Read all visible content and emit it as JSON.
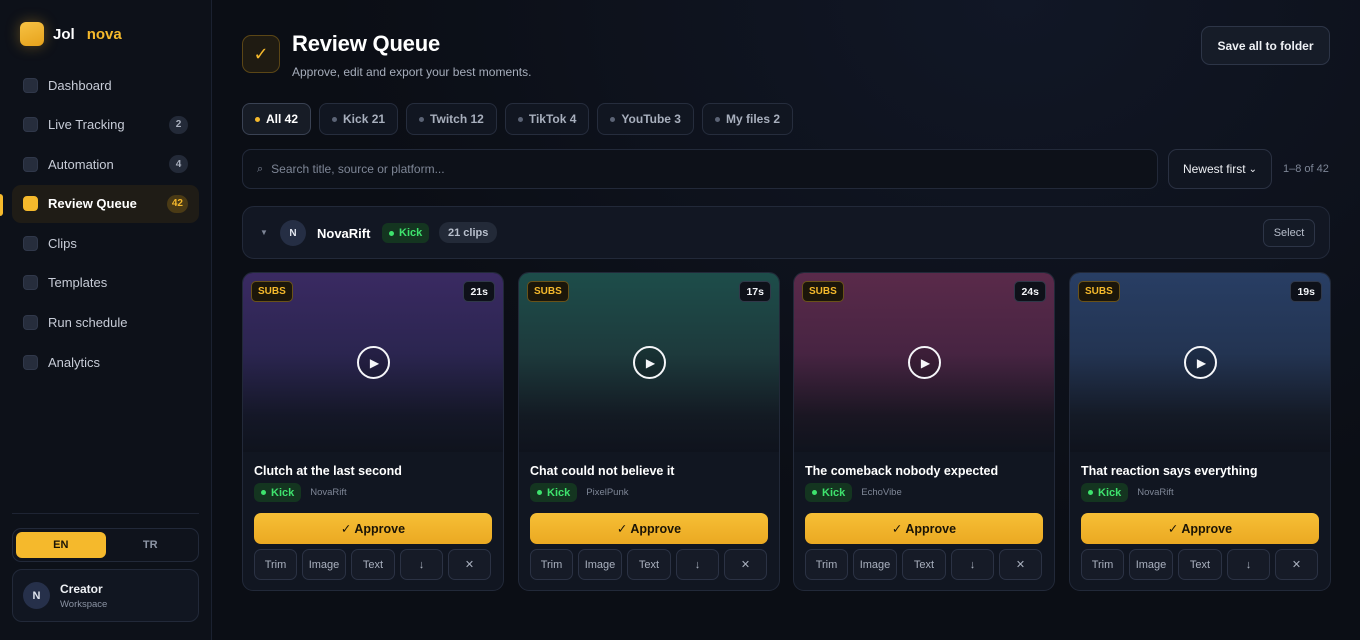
{
  "brand": {
    "name_a": "Jol",
    "name_b": "nova"
  },
  "sidebar": {
    "items": [
      {
        "label": "Dashboard",
        "badge": ""
      },
      {
        "label": "Live Tracking",
        "badge": "2"
      },
      {
        "label": "Automation",
        "badge": "4"
      },
      {
        "label": "Review Queue",
        "badge": "42",
        "active": true
      },
      {
        "label": "Clips",
        "badge": ""
      },
      {
        "label": "Templates",
        "badge": ""
      },
      {
        "label": "Run schedule",
        "badge": ""
      },
      {
        "label": "Analytics",
        "badge": ""
      }
    ],
    "languages": [
      "EN",
      "TR"
    ],
    "selected_language": "EN",
    "user": {
      "initial": "N",
      "name": "Creator",
      "sub": "Workspace"
    }
  },
  "header": {
    "icon": "check-icon",
    "icon_glyph": "✓",
    "title": "Review Queue",
    "subtitle": "Approve, edit and export your best moments.",
    "save_label": "Save all to folder"
  },
  "filters": [
    {
      "label": "All 42",
      "active": true
    },
    {
      "label": "Kick 21"
    },
    {
      "label": "Twitch 12"
    },
    {
      "label": "TikTok 4"
    },
    {
      "label": "YouTube 3"
    },
    {
      "label": "My files 2"
    }
  ],
  "search": {
    "placeholder": "Search title, source or platform...",
    "icon_glyph": "⌕"
  },
  "sort": {
    "label": "Newest first",
    "caret": "⌄"
  },
  "range_text": "1–8 of 42",
  "group": {
    "caret": "▼",
    "initial": "N",
    "name": "NovaRift",
    "platform": "Kick",
    "count": "21 clips",
    "select_label": "Select"
  },
  "colors": {
    "accent": "#f5b92c",
    "kick_green": "#3ee36d",
    "background": "#0b0e15"
  },
  "cards": [
    {
      "badge": "SUBS",
      "duration": "21s",
      "title": "Clutch at the last second",
      "platform": "Kick",
      "source": "NovaRift",
      "approve": "✓ Approve",
      "actions": [
        "Trim",
        "Image",
        "Text",
        "↓",
        "✕"
      ]
    },
    {
      "badge": "SUBS",
      "duration": "17s",
      "title": "Chat could not believe it",
      "platform": "Kick",
      "source": "PixelPunk",
      "approve": "✓ Approve",
      "actions": [
        "Trim",
        "Image",
        "Text",
        "↓",
        "✕"
      ]
    },
    {
      "badge": "SUBS",
      "duration": "24s",
      "title": "The comeback nobody expected",
      "platform": "Kick",
      "source": "EchoVibe",
      "approve": "✓ Approve",
      "actions": [
        "Trim",
        "Image",
        "Text",
        "↓",
        "✕"
      ]
    },
    {
      "badge": "SUBS",
      "duration": "19s",
      "title": "That reaction says everything",
      "platform": "Kick",
      "source": "NovaRift",
      "approve": "✓ Approve",
      "actions": [
        "Trim",
        "Image",
        "Text",
        "↓",
        "✕"
      ]
    }
  ]
}
